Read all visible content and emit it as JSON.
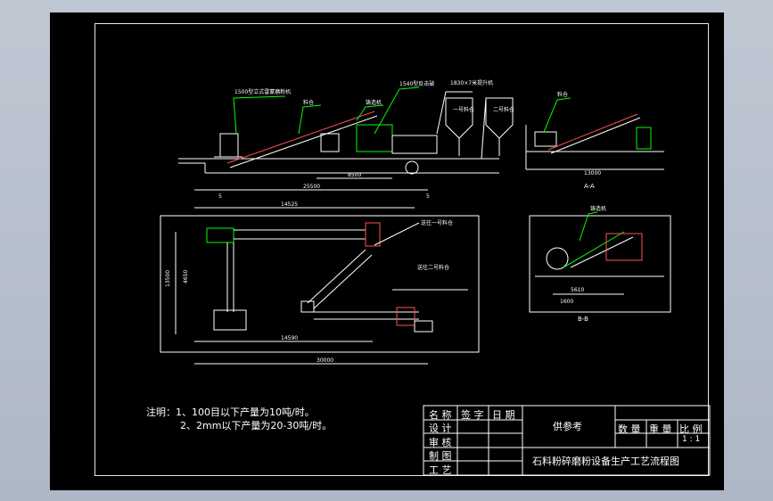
{
  "drawing": {
    "section_labels": {
      "aa": "A-A",
      "bb": "B-B"
    },
    "main_dimensions": {
      "elev_total": "25500",
      "elev_mid": "8500",
      "elev_left": "5",
      "elev_right": "5",
      "plan_total": "30000",
      "plan_top": "14525",
      "plan_bottom": "14590",
      "plan_left_height": "13500",
      "plan_mid_height": "4650",
      "aa_span": "13000",
      "bb_span1": "5610",
      "bb_span2": "1600"
    },
    "labels": {
      "mill": "1500型立式雷蒙磨粉机",
      "belt1": "铸造机",
      "belt2": "皮带机",
      "crusher": "1540型反击破",
      "silo": "1830×7米提升机",
      "feed_left": "料仓",
      "feed_right": "料仓",
      "silo1": "一号料仓",
      "silo2": "二号料仓",
      "conveyor_note": "送往一号料仓",
      "conveyor_note2": "送往二号料仓",
      "aa_label": "料仓",
      "bb_label": "铸造机"
    }
  },
  "notes": {
    "heading": "注明：",
    "line1": "1、100目以下产量为10吨/时。",
    "line2": "2、2mm以下产量为20-30吨/时。"
  },
  "title_block": {
    "col_name": "名 称",
    "col_sign": "签 字",
    "col_date": "日 期",
    "row_design": "设 计",
    "row_check": "审 核",
    "row_draw": "制 图",
    "row_craft": "工 艺",
    "reference": "供参考",
    "qty": "数 量",
    "weight": "重 量",
    "scale": "比 例",
    "scale_value": "1 : 1",
    "drawing_title": "石料粉碎磨粉设备生产工艺流程图"
  }
}
